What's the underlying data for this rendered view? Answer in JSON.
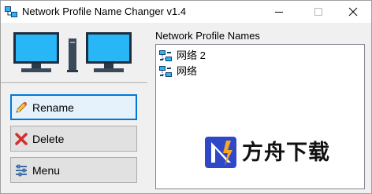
{
  "window": {
    "title": "Network Profile Name Changer v1.4",
    "controls": [
      "minimize",
      "maximize",
      "close"
    ]
  },
  "buttons": {
    "rename": {
      "label": "Rename",
      "icon": "pencil-icon"
    },
    "delete": {
      "label": "Delete",
      "icon": "red-x-icon"
    },
    "menu": {
      "label": "Menu",
      "icon": "sliders-icon"
    }
  },
  "profiles": {
    "caption": "Network Profile Names",
    "items": [
      {
        "name": "网络 2",
        "icon": "network-icon"
      },
      {
        "name": "网络",
        "icon": "network-icon"
      }
    ]
  },
  "watermark": {
    "text": "方舟下载",
    "logo": "ark-logo"
  },
  "colors": {
    "accent": "#0078d7",
    "monitor_screen": "#29b6f6",
    "delete_red": "#d32f2f",
    "logo_blue": "#2f48c8",
    "logo_orange": "#f5a623"
  }
}
